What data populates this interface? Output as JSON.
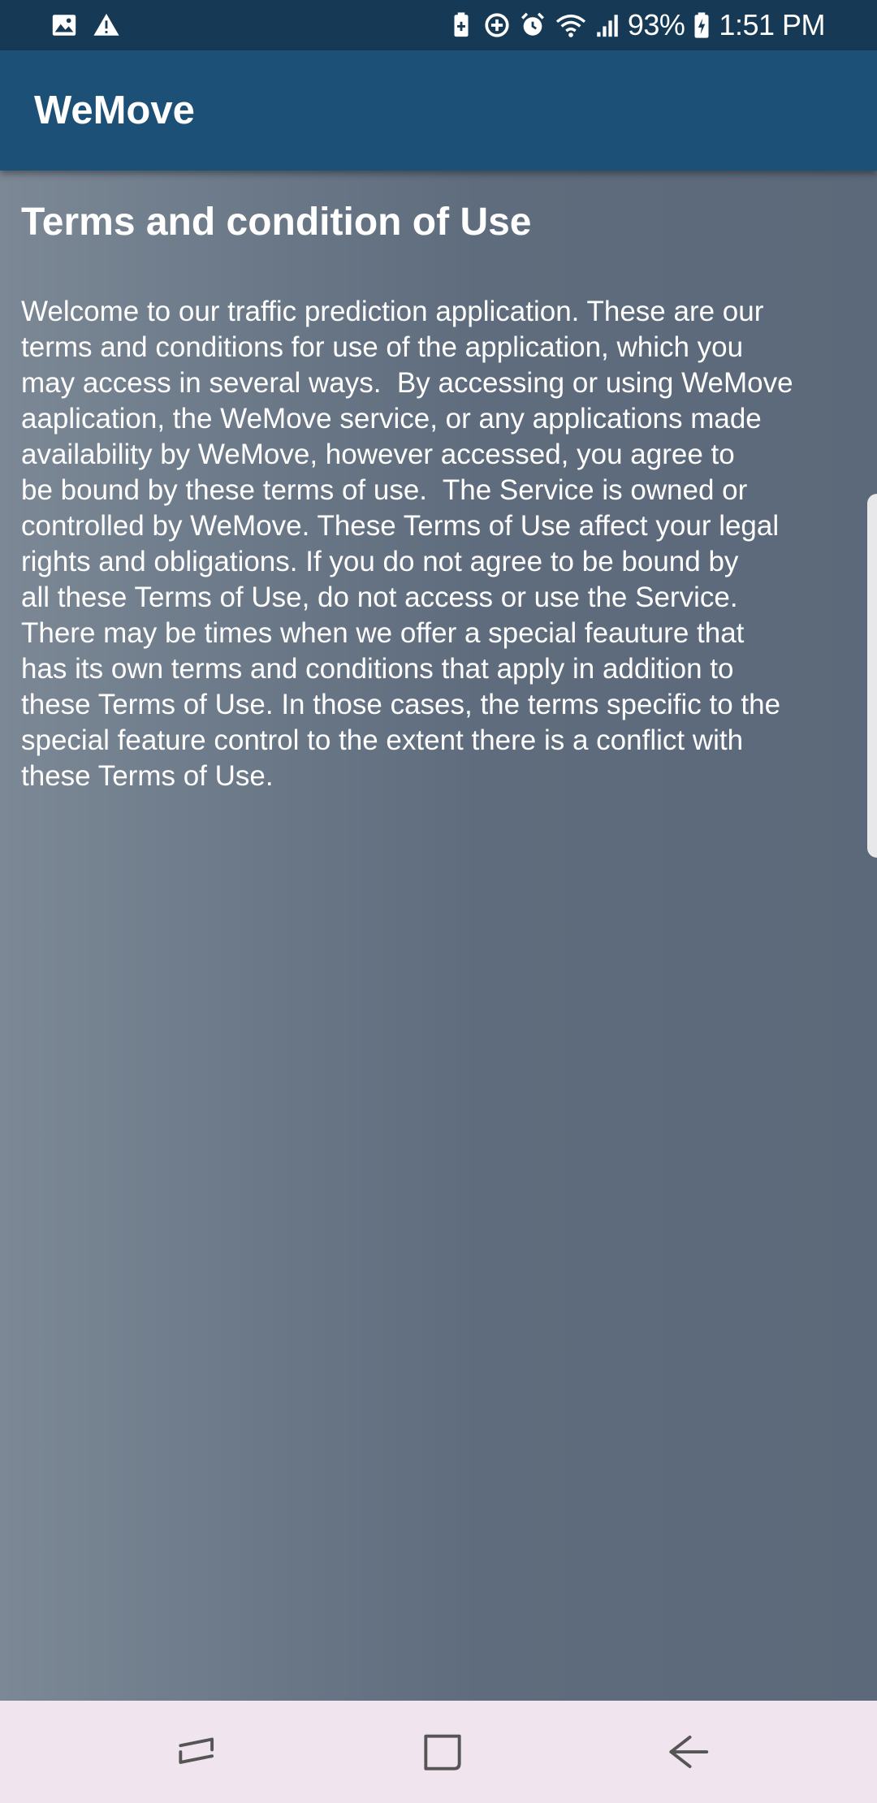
{
  "status_bar": {
    "left_icons": [
      "gallery-icon",
      "warning-icon"
    ],
    "right_icons": [
      "battery-saver-icon",
      "data-saver-icon",
      "alarm-icon",
      "wifi-icon",
      "signal-icon",
      "battery-charging-icon"
    ],
    "battery_percent": "93%",
    "time": "1:51 PM"
  },
  "app_bar": {
    "title": "WeMove"
  },
  "content": {
    "heading": "Terms and condition of Use",
    "body_lines": [
      "Welcome to our traffic prediction application. These are our",
      "terms and conditions for use of the application, which you",
      "may access in several ways.  By accessing or using WeMove",
      "aaplication, the WeMove service, or any applications made",
      "availability by WeMove, however accessed, you agree to",
      "be bound by these terms of use.  The Service is owned or",
      "controlled by WeMove. These Terms of Use affect your legal",
      "rights and obligations. If you do not agree to be bound by",
      "all these Terms of Use, do not access or use the Service.",
      "There may be times when we offer a special feauture that",
      "has its own terms and conditions that apply in addition to",
      "these Terms of Use. In those cases, the terms specific to the",
      "special feature control to the extent there is a conflict with",
      "these Terms of Use."
    ]
  },
  "nav_bar": {
    "buttons": [
      "recent-apps",
      "home",
      "back"
    ]
  },
  "colors": {
    "status_bar": "#163a55",
    "app_bar": "#1c5077",
    "nav_bar": "#f0e4ee",
    "content_bg": "#5e6c7d"
  }
}
